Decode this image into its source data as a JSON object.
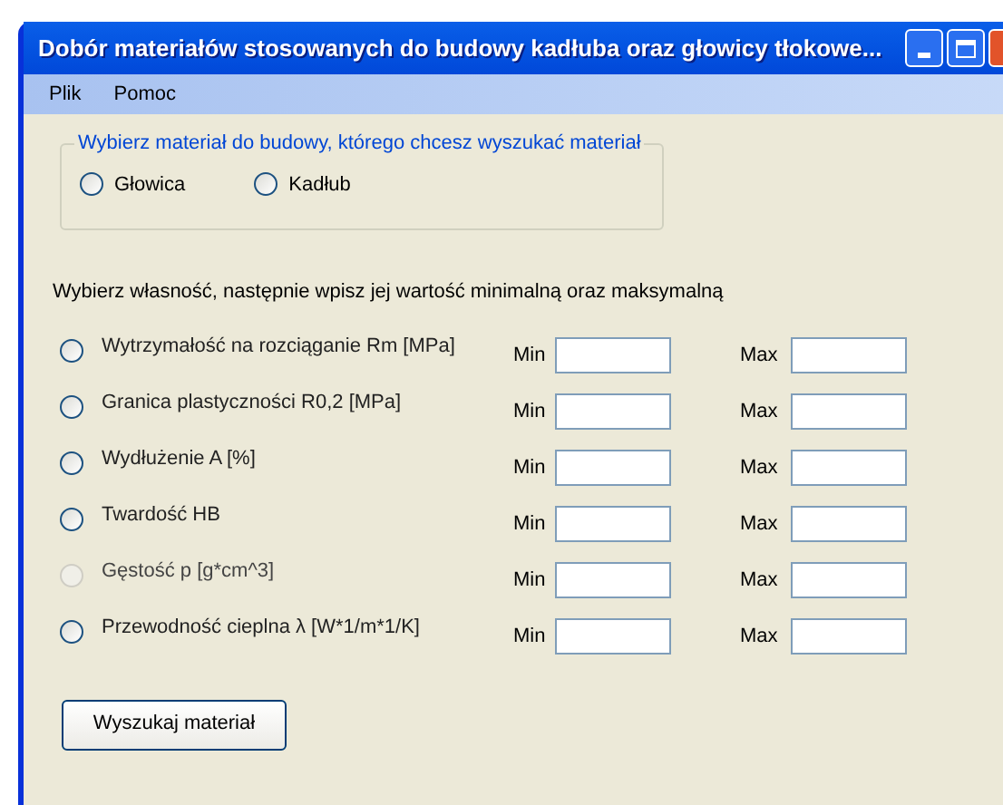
{
  "window": {
    "title": "Dobór materiałów stosowanych do budowy kadłuba oraz głowicy tłokowe..."
  },
  "menu": [
    "Plik",
    "Pomoc"
  ],
  "group": {
    "legend": "Wybierz materiał do budowy, którego chcesz wyszukać materiał",
    "options": [
      {
        "label": "Głowica",
        "selected": false
      },
      {
        "label": "Kadłub",
        "selected": false
      }
    ]
  },
  "instruction": "Wybierz własność, następnie wpisz jej wartość minimalną oraz maksymalną",
  "properties": [
    {
      "label": "Wytrzymałość na rozciąganie Rm [MPa]",
      "selected": false,
      "disabled": false,
      "min_label": "Min",
      "max_label": "Max"
    },
    {
      "label": "Granica plastyczności R0,2 [MPa]",
      "selected": false,
      "disabled": false,
      "min_label": "Min",
      "max_label": "Max"
    },
    {
      "label": "Wydłużenie A [%]",
      "selected": false,
      "disabled": false,
      "min_label": "Min",
      "max_label": "Max"
    },
    {
      "label": "Twardość HB",
      "selected": false,
      "disabled": false,
      "min_label": "Min",
      "max_label": "Max"
    },
    {
      "label": "Gęstość p [g*cm^3]",
      "selected": false,
      "disabled": true,
      "min_label": "Min",
      "max_label": "Max"
    },
    {
      "label": "Przewodność cieplna λ  [W*1/m*1/K]",
      "selected": false,
      "disabled": false,
      "min_label": "Min",
      "max_label": "Max"
    }
  ],
  "search_button": "Wyszukaj materiał"
}
